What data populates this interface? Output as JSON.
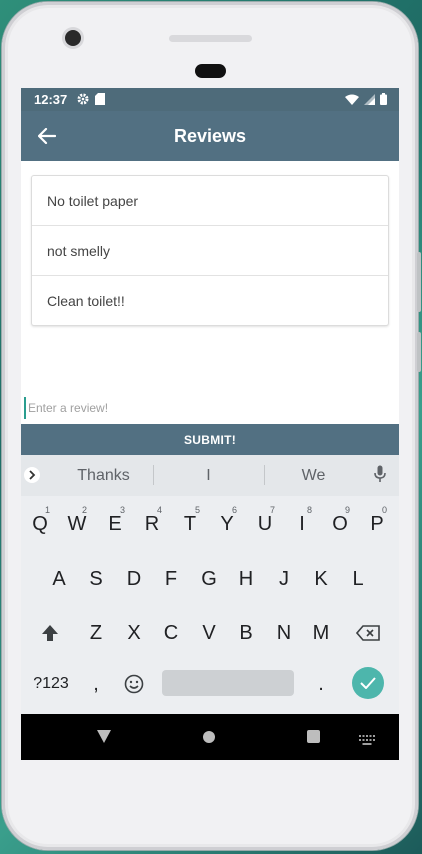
{
  "status": {
    "time": "12:37"
  },
  "appbar": {
    "title": "Reviews"
  },
  "reviews": [
    {
      "text": "No toilet paper"
    },
    {
      "text": "not smelly"
    },
    {
      "text": "Clean toilet!!"
    }
  ],
  "form": {
    "placeholder": "Enter a review!",
    "value": "",
    "submit_label": "SUBMIT!"
  },
  "keyboard": {
    "suggestions": [
      "Thanks",
      "I",
      "We"
    ],
    "row1": [
      "Q",
      "W",
      "E",
      "R",
      "T",
      "Y",
      "U",
      "I",
      "O",
      "P"
    ],
    "row1_hints": [
      "1",
      "2",
      "3",
      "4",
      "5",
      "6",
      "7",
      "8",
      "9",
      "0"
    ],
    "row2": [
      "A",
      "S",
      "D",
      "F",
      "G",
      "H",
      "J",
      "K",
      "L"
    ],
    "row3": [
      "Z",
      "X",
      "C",
      "V",
      "B",
      "N",
      "M"
    ],
    "symbols_label": "?123",
    "comma": ",",
    "period": "."
  },
  "colors": {
    "appbar": "#527082",
    "statusbar": "#4e6b7a",
    "accent": "#4db6ac"
  }
}
